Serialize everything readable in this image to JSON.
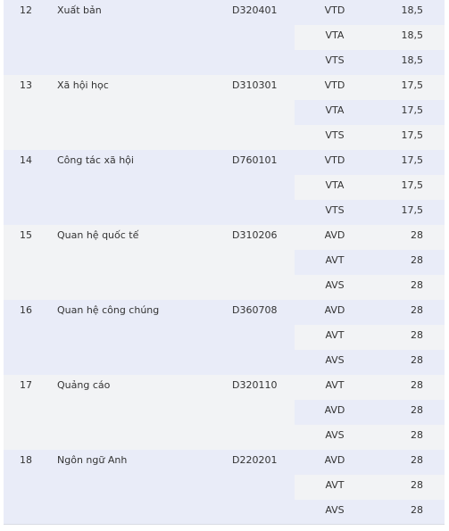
{
  "table": {
    "groups": [
      {
        "stt": "12",
        "name": "Xuất bản",
        "code": "D320401",
        "rows": [
          {
            "block": "VTD",
            "score": "18,5"
          },
          {
            "block": "VTA",
            "score": "18,5"
          },
          {
            "block": "VTS",
            "score": "18,5"
          }
        ]
      },
      {
        "stt": "13",
        "name": "Xã hội học",
        "code": "D310301",
        "rows": [
          {
            "block": "VTD",
            "score": "17,5"
          },
          {
            "block": "VTA",
            "score": "17,5"
          },
          {
            "block": "VTS",
            "score": "17,5"
          }
        ]
      },
      {
        "stt": "14",
        "name": "Công tác xã hội",
        "code": "D760101",
        "rows": [
          {
            "block": "VTD",
            "score": "17,5"
          },
          {
            "block": "VTA",
            "score": "17,5"
          },
          {
            "block": "VTS",
            "score": "17,5"
          }
        ]
      },
      {
        "stt": "15",
        "name": "Quan hệ quốc tế",
        "code": "D310206",
        "rows": [
          {
            "block": "AVD",
            "score": "28"
          },
          {
            "block": "AVT",
            "score": "28"
          },
          {
            "block": "AVS",
            "score": "28"
          }
        ]
      },
      {
        "stt": "16",
        "name": "Quan hệ công chúng",
        "code": "D360708",
        "rows": [
          {
            "block": "AVD",
            "score": "28"
          },
          {
            "block": "AVT",
            "score": "28"
          },
          {
            "block": "AVS",
            "score": "28"
          }
        ]
      },
      {
        "stt": "17",
        "name": "Quảng cáo",
        "code": "D320110",
        "rows": [
          {
            "block": "AVT",
            "score": "28"
          },
          {
            "block": "AVD",
            "score": "28"
          },
          {
            "block": "AVS",
            "score": "28"
          }
        ]
      },
      {
        "stt": "18",
        "name": "Ngôn ngữ Anh",
        "code": "D220201",
        "rows": [
          {
            "block": "AVD",
            "score": "28"
          },
          {
            "block": "AVT",
            "score": "28"
          },
          {
            "block": "AVS",
            "score": "28"
          }
        ]
      }
    ]
  },
  "colors": {
    "row_blue": "#e9ecf8",
    "row_grey": "#f2f3f5",
    "text": "#333333"
  }
}
